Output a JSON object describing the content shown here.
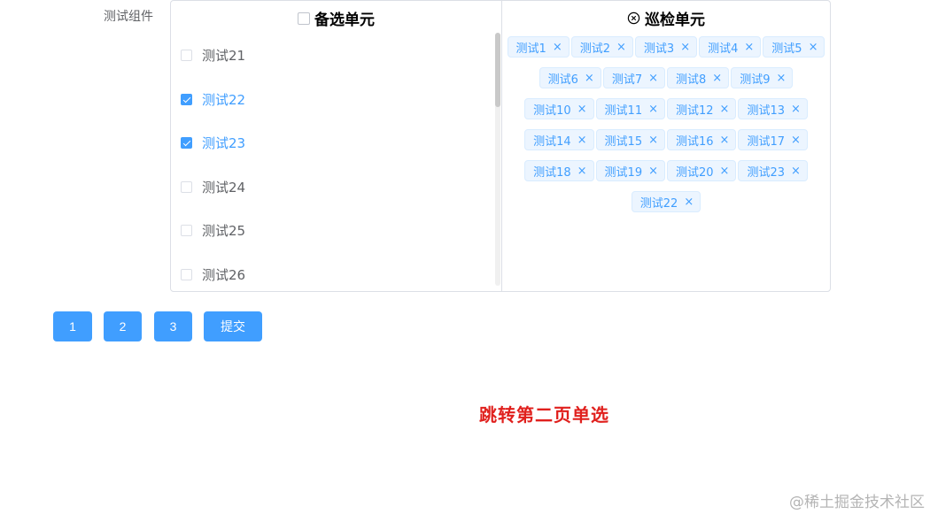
{
  "form": {
    "label": "测试组件"
  },
  "transfer": {
    "left_header": "备选单元",
    "right_header": "巡检单元",
    "left_items": [
      {
        "label": "测试21",
        "checked": false
      },
      {
        "label": "测试22",
        "checked": true
      },
      {
        "label": "测试23",
        "checked": true
      },
      {
        "label": "测试24",
        "checked": false
      },
      {
        "label": "测试25",
        "checked": false
      },
      {
        "label": "测试26",
        "checked": false
      }
    ],
    "selected_tags": [
      [
        "测试1",
        "测试2",
        "测试3",
        "测试4",
        "测试5"
      ],
      [
        "测试6",
        "测试7",
        "测试8",
        "测试9"
      ],
      [
        "测试10",
        "测试11",
        "测试12",
        "测试13"
      ],
      [
        "测试14",
        "测试15",
        "测试16",
        "测试17"
      ],
      [
        "测试18",
        "测试19",
        "测试20",
        "测试23"
      ],
      [
        "测试22"
      ]
    ],
    "tag_close_glyph": "×"
  },
  "buttons": {
    "page1": "1",
    "page2": "2",
    "page3": "3",
    "submit": "提交"
  },
  "caption": "跳转第二页单选",
  "watermark": "@稀土掘金技术社区",
  "colors": {
    "primary": "#409eff",
    "caption": "#e0201d"
  },
  "icons": {
    "right_header_icon": "circle-close-icon"
  }
}
